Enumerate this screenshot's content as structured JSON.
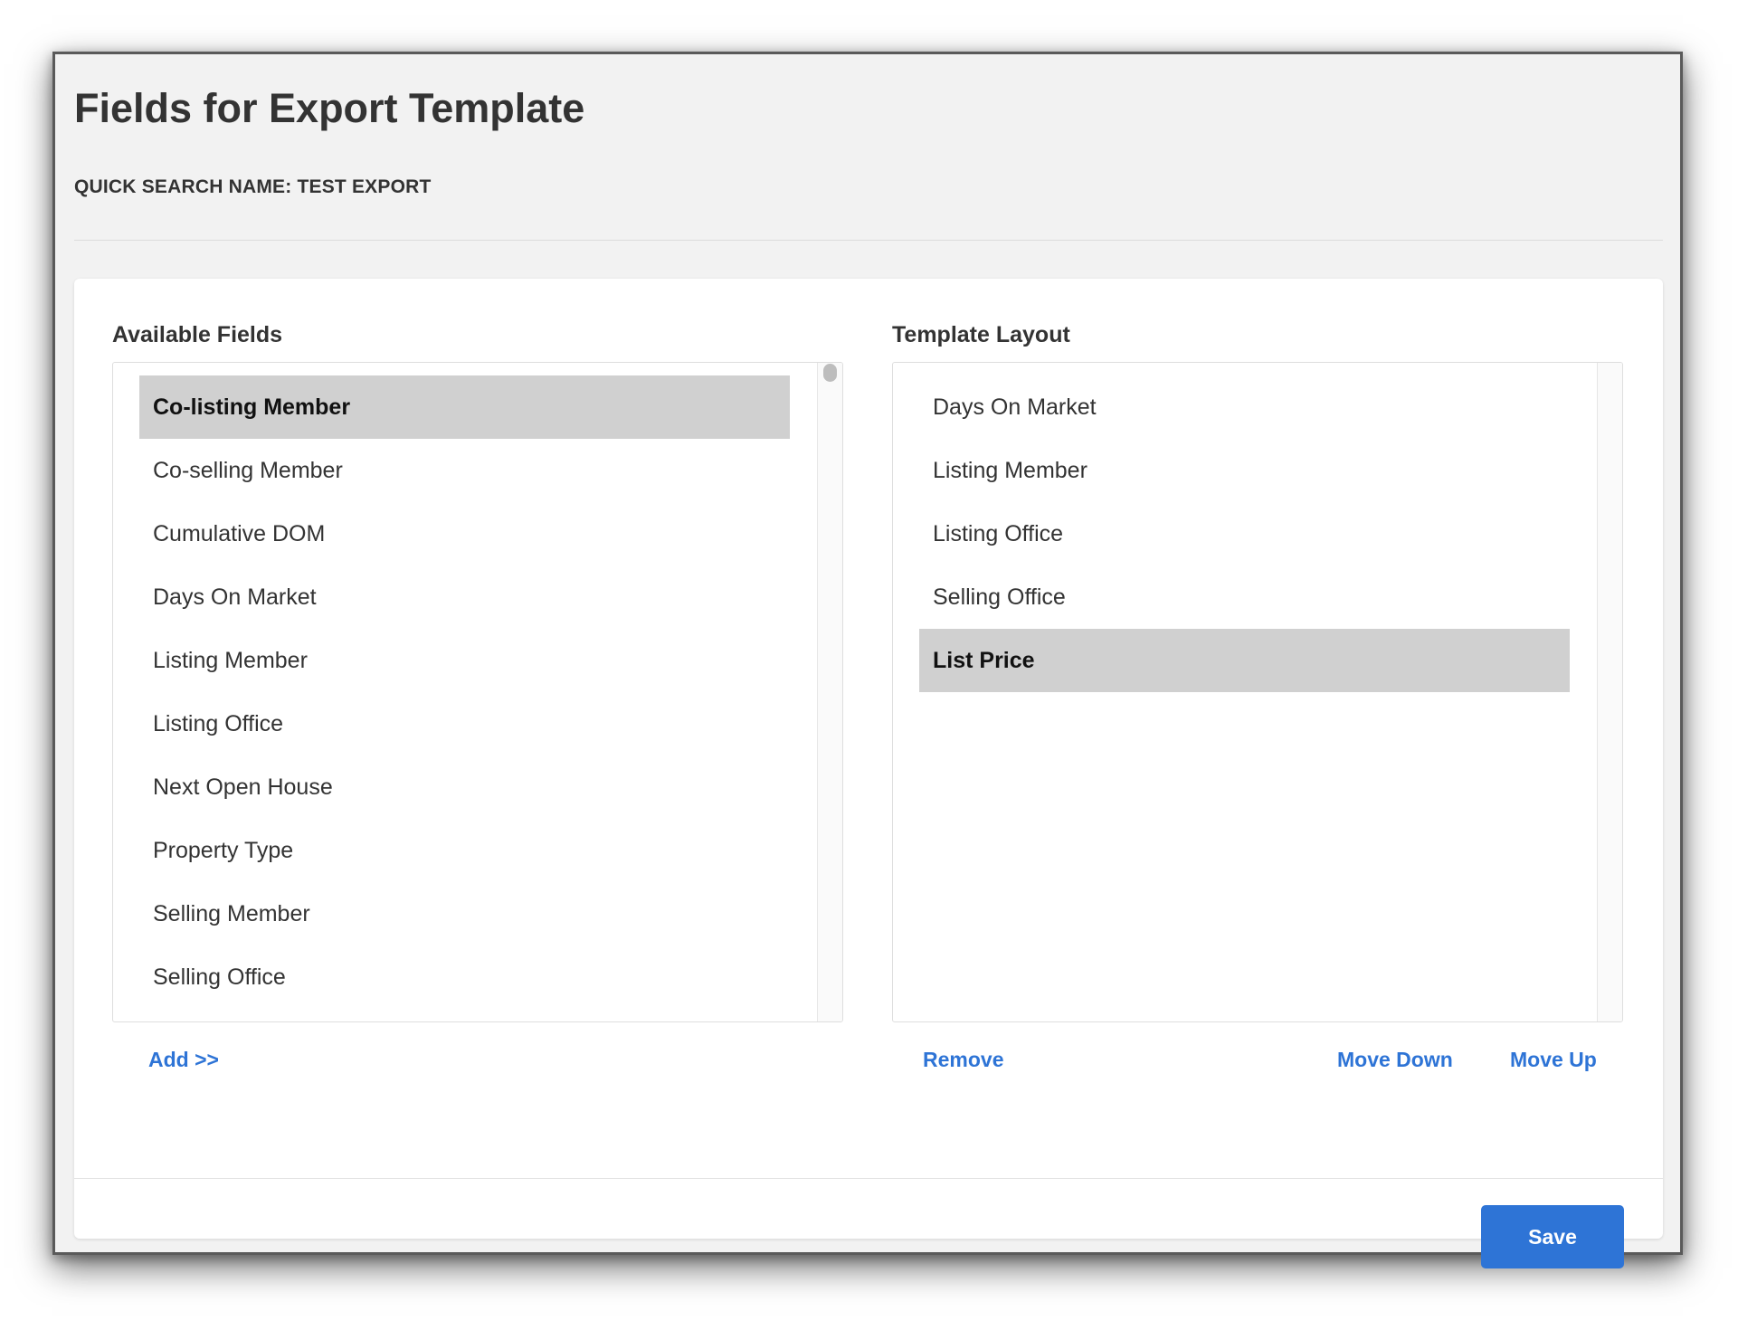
{
  "dialog": {
    "title": "Fields for Export Template",
    "subtitle": "QUICK SEARCH NAME: TEST EXPORT"
  },
  "available": {
    "label": "Available Fields",
    "items": [
      {
        "label": "Co-listing Member",
        "selected": true
      },
      {
        "label": "Co-selling Member",
        "selected": false
      },
      {
        "label": "Cumulative DOM",
        "selected": false
      },
      {
        "label": "Days On Market",
        "selected": false
      },
      {
        "label": "Listing Member",
        "selected": false
      },
      {
        "label": "Listing Office",
        "selected": false
      },
      {
        "label": "Next Open House",
        "selected": false
      },
      {
        "label": "Property Type",
        "selected": false
      },
      {
        "label": "Selling Member",
        "selected": false
      },
      {
        "label": "Selling Office",
        "selected": false
      }
    ],
    "add_label": "Add >>"
  },
  "template": {
    "label": "Template Layout",
    "items": [
      {
        "label": "Days On Market",
        "selected": false
      },
      {
        "label": "Listing Member",
        "selected": false
      },
      {
        "label": "Listing Office",
        "selected": false
      },
      {
        "label": "Selling Office",
        "selected": false
      },
      {
        "label": "List Price",
        "selected": true
      }
    ],
    "remove_label": "Remove",
    "move_down_label": "Move Down",
    "move_up_label": "Move Up"
  },
  "footer": {
    "save_label": "Save"
  },
  "colors": {
    "accent": "#2e74d6",
    "selected_row": "#d0d0d0"
  }
}
